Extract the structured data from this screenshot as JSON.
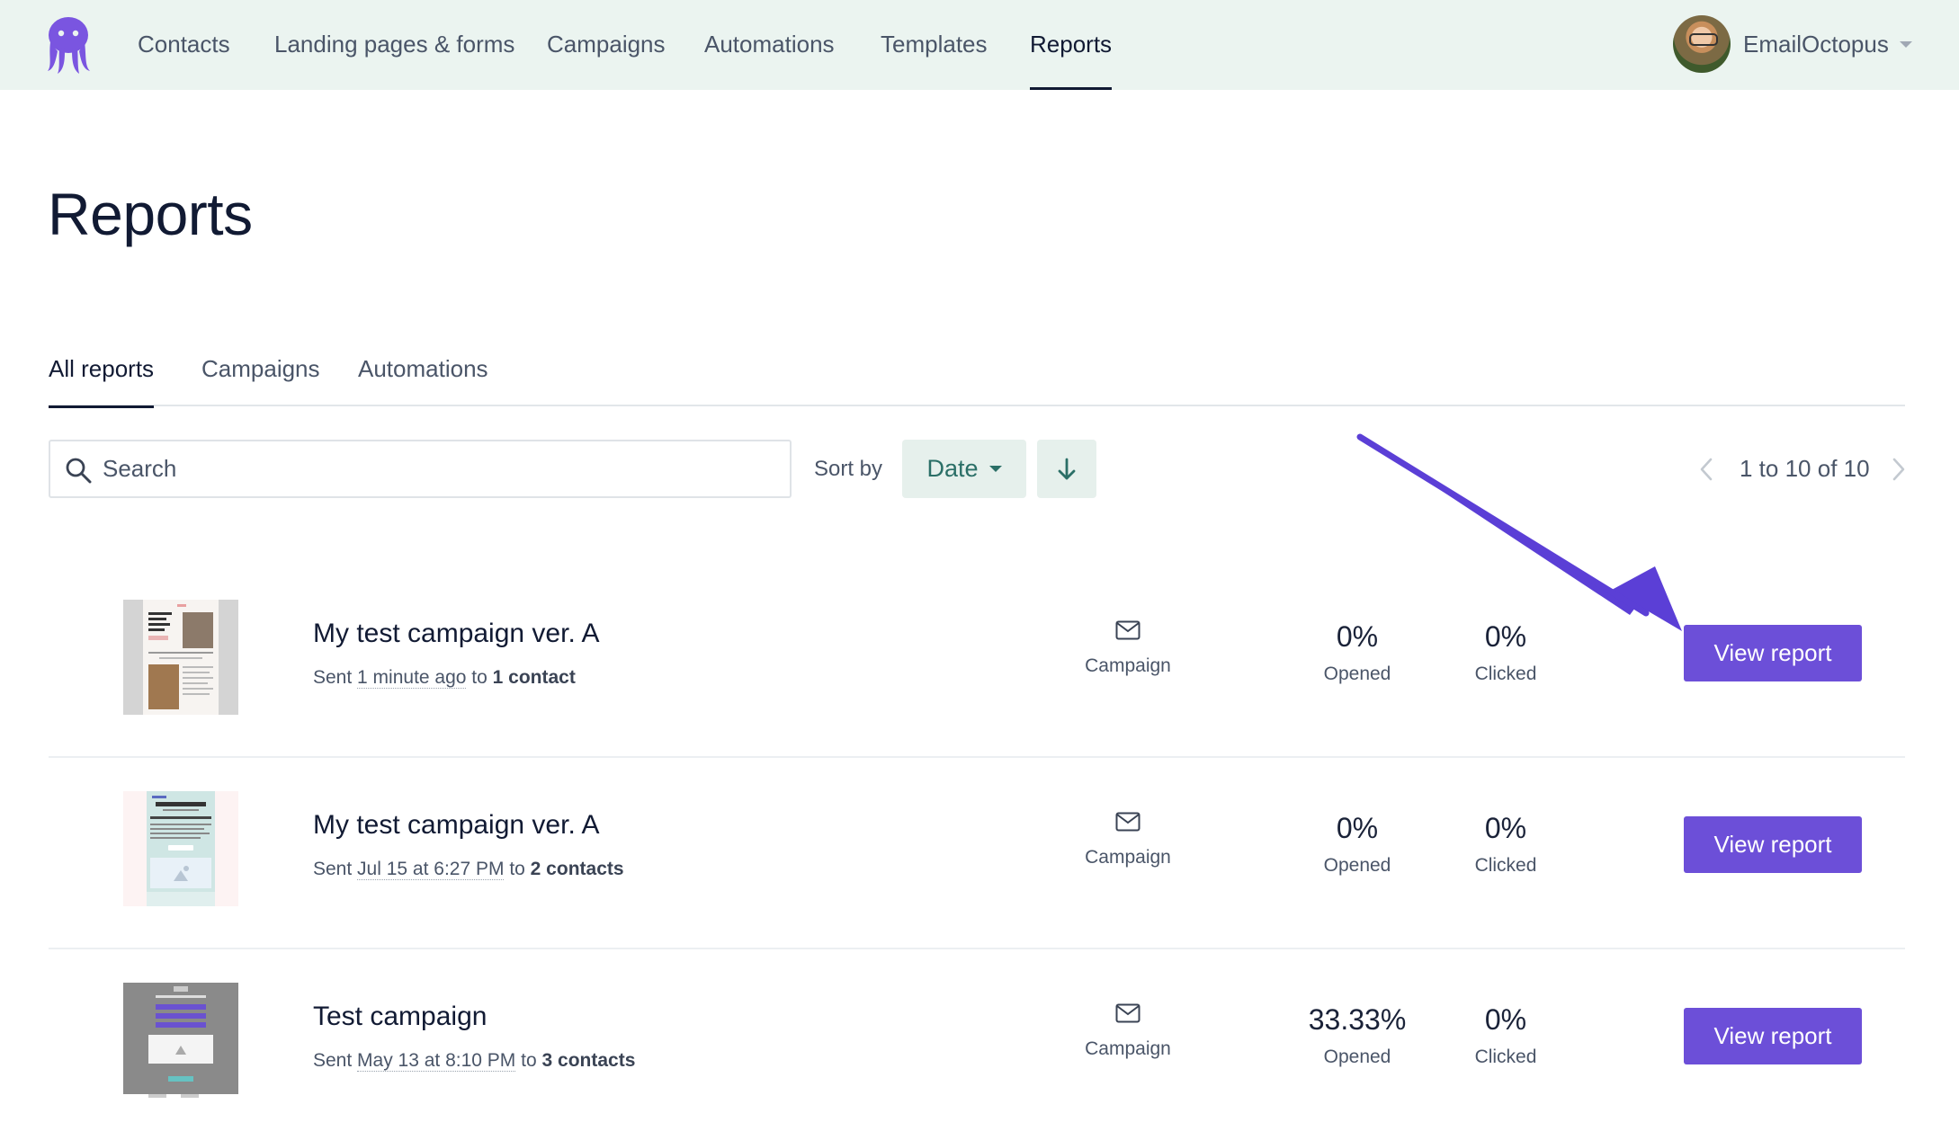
{
  "nav": {
    "items": [
      {
        "label": "Contacts"
      },
      {
        "label": "Landing pages & forms"
      },
      {
        "label": "Campaigns"
      },
      {
        "label": "Automations"
      },
      {
        "label": "Templates"
      },
      {
        "label": "Reports"
      }
    ],
    "active": "Reports",
    "account_name": "EmailOctopus"
  },
  "page": {
    "title": "Reports"
  },
  "tabs": [
    {
      "label": "All reports"
    },
    {
      "label": "Campaigns"
    },
    {
      "label": "Automations"
    }
  ],
  "toolbar": {
    "search_placeholder": "Search",
    "sort_label": "Sort by",
    "sort_value": "Date",
    "pagination": "1 to 10 of 10"
  },
  "reports": [
    {
      "title": "My test campaign ver. A",
      "sent_prefix": "Sent ",
      "sent_time": "1 minute ago",
      "sent_to": " to ",
      "recipients": "1 contact",
      "type": "Campaign",
      "opened": "0%",
      "opened_label": "Opened",
      "clicked": "0%",
      "clicked_label": "Clicked",
      "button": "View report"
    },
    {
      "title": "My test campaign ver. A",
      "sent_prefix": "Sent ",
      "sent_time": "Jul 15 at 6:27 PM",
      "sent_to": " to ",
      "recipients": "2 contacts",
      "type": "Campaign",
      "opened": "0%",
      "opened_label": "Opened",
      "clicked": "0%",
      "clicked_label": "Clicked",
      "button": "View report"
    },
    {
      "title": "Test campaign",
      "sent_prefix": "Sent ",
      "sent_time": "May 13 at 8:10 PM",
      "sent_to": " to ",
      "recipients": "3 contacts",
      "type": "Campaign",
      "opened": "33.33%",
      "opened_label": "Opened",
      "clicked": "0%",
      "clicked_label": "Clicked",
      "button": "View report"
    }
  ],
  "colors": {
    "nav_background": "#ebf4f0",
    "brand_purple": "#6c4fd8",
    "sort_button_background": "#e6f0ec",
    "annotation_arrow": "#5b3fd6"
  }
}
